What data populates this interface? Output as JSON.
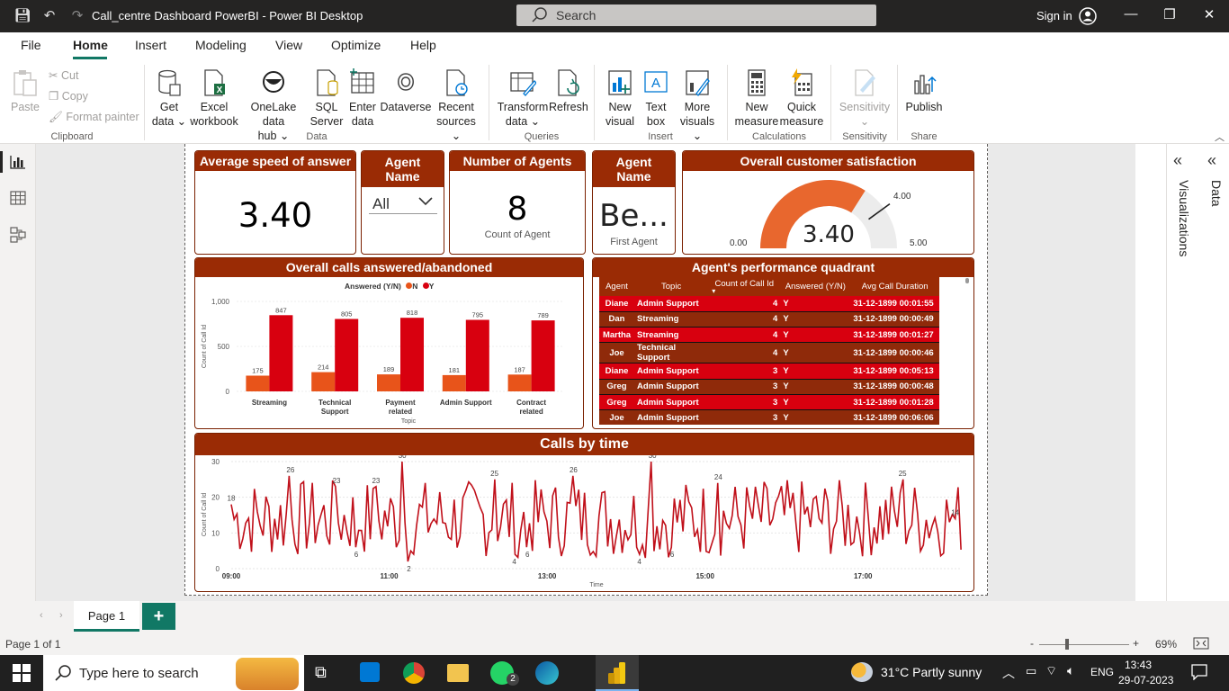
{
  "window": {
    "title": "Call_centre Dashboard PowerBI - Power BI Desktop",
    "search_placeholder": "Search",
    "sign_in": "Sign in"
  },
  "menu": [
    "File",
    "Home",
    "Insert",
    "Modeling",
    "View",
    "Optimize",
    "Help"
  ],
  "ribbon": {
    "clipboard": {
      "paste": "Paste",
      "cut": "Cut",
      "copy": "Copy",
      "format_painter": "Format painter",
      "group": "Clipboard"
    },
    "data": {
      "get_data": [
        "Get",
        "data ⌄"
      ],
      "excel": [
        "Excel",
        "workbook"
      ],
      "onelake": [
        "OneLake data",
        "hub ⌄"
      ],
      "sql": [
        "SQL",
        "Server"
      ],
      "enter": [
        "Enter",
        "data"
      ],
      "dataverse": [
        "Dataverse",
        ""
      ],
      "recent": [
        "Recent",
        "sources ⌄"
      ],
      "group": "Data"
    },
    "queries": {
      "transform": [
        "Transform",
        "data ⌄"
      ],
      "refresh": [
        "Refresh",
        ""
      ],
      "group": "Queries"
    },
    "insert": {
      "new_visual": [
        "New",
        "visual"
      ],
      "text_box": [
        "Text",
        "box"
      ],
      "more_visuals": [
        "More",
        "visuals ⌄"
      ],
      "group": "Insert"
    },
    "calculations": {
      "new_measure": [
        "New",
        "measure"
      ],
      "quick_measure": [
        "Quick",
        "measure"
      ],
      "group": "Calculations"
    },
    "sensitivity": {
      "label": [
        "Sensitivity",
        "⌄"
      ],
      "group": "Sensitivity"
    },
    "share": {
      "publish": [
        "Publish",
        ""
      ],
      "group": "Share"
    }
  },
  "cards": {
    "avg_speed": {
      "title": "Average speed of answer",
      "value": "3.40"
    },
    "agent_slicer": {
      "title": "Agent Name",
      "value": "All"
    },
    "num_agents": {
      "title": "Number of Agents",
      "value": "8",
      "sub": "Count of Agent"
    },
    "first_agent": {
      "title": "Agent Name",
      "value": "Be...",
      "sub": "First Agent"
    },
    "satisfaction": {
      "title": "Overall customer satisfaction",
      "value": "3.40",
      "min": "0.00",
      "max": "5.00",
      "target": "4.00"
    }
  },
  "bar_chart": {
    "title": "Overall calls answered/abandoned",
    "legend_title": "Answered (Y/N)",
    "legend": [
      "N",
      "Y"
    ],
    "xlabel": "Topic",
    "ylabel": "Count of Call Id",
    "ticks": [
      "1,000",
      "500",
      "0"
    ]
  },
  "perf_table": {
    "title": "Agent's performance quadrant",
    "columns": [
      "Agent",
      "Topic",
      "Count of Call Id",
      "Answered (Y/N)",
      "Avg Call Duration"
    ],
    "rows": [
      [
        "Diane",
        "Admin Support",
        "4",
        "Y",
        "31-12-1899 00:01:55"
      ],
      [
        "Dan",
        "Streaming",
        "4",
        "Y",
        "31-12-1899 00:00:49"
      ],
      [
        "Martha",
        "Streaming",
        "4",
        "Y",
        "31-12-1899 00:01:27"
      ],
      [
        "Joe",
        "Technical Support",
        "4",
        "Y",
        "31-12-1899 00:00:46"
      ],
      [
        "Diane",
        "Admin Support",
        "3",
        "Y",
        "31-12-1899 00:05:13"
      ],
      [
        "Greg",
        "Admin Support",
        "3",
        "Y",
        "31-12-1899 00:00:48"
      ],
      [
        "Greg",
        "Admin Support",
        "3",
        "Y",
        "31-12-1899 00:01:28"
      ],
      [
        "Joe",
        "Admin Support",
        "3",
        "Y",
        "31-12-1899 00:06:06"
      ]
    ]
  },
  "line_chart": {
    "title": "Calls by time",
    "xlabel": "Time",
    "ylabel": "Count of Call Id",
    "yticks": [
      "30",
      "20",
      "10",
      "0"
    ],
    "xticks": [
      "09:00",
      "11:00",
      "13:00",
      "15:00",
      "17:00"
    ]
  },
  "chart_data": [
    {
      "type": "bar",
      "title": "Overall calls answered/abandoned",
      "xlabel": "Topic",
      "ylabel": "Count of Call Id",
      "ylim": [
        0,
        1000
      ],
      "categories": [
        "Streaming",
        "Technical Support",
        "Payment related",
        "Admin Support",
        "Contract related"
      ],
      "series": [
        {
          "name": "N",
          "color": "#e8541a",
          "values": [
            175,
            214,
            189,
            181,
            187
          ]
        },
        {
          "name": "Y",
          "color": "#d8000f",
          "values": [
            847,
            805,
            818,
            795,
            789
          ]
        }
      ]
    },
    {
      "type": "line",
      "title": "Calls by time",
      "xlabel": "Time",
      "ylabel": "Count of Call Id",
      "ylim": [
        0,
        30
      ],
      "xrange": [
        "09:00",
        "18:15"
      ],
      "color": "#c0101a",
      "labeled_points": [
        {
          "x": "09:00",
          "y": 18
        },
        {
          "x": "09:45",
          "y": 26
        },
        {
          "x": "10:20",
          "y": 23
        },
        {
          "x": "10:35",
          "y": 6
        },
        {
          "x": "10:50",
          "y": 23
        },
        {
          "x": "11:10",
          "y": 30
        },
        {
          "x": "11:15",
          "y": 2
        },
        {
          "x": "12:20",
          "y": 25
        },
        {
          "x": "12:35",
          "y": 4
        },
        {
          "x": "12:45",
          "y": 6
        },
        {
          "x": "13:20",
          "y": 26
        },
        {
          "x": "14:10",
          "y": 4
        },
        {
          "x": "14:20",
          "y": 30
        },
        {
          "x": "14:35",
          "y": 6
        },
        {
          "x": "15:10",
          "y": 24
        },
        {
          "x": "17:30",
          "y": 25
        },
        {
          "x": "18:10",
          "y": 14
        }
      ]
    },
    {
      "type": "gauge",
      "title": "Overall customer satisfaction",
      "value": 3.4,
      "min": 0,
      "max": 5,
      "target": 4.0
    }
  ],
  "right_panes": {
    "visualizations": "Visualizations",
    "data": "Data"
  },
  "pages": {
    "tab": "Page 1",
    "add": "+"
  },
  "status": {
    "page": "Page 1 of 1",
    "zoom": "69%",
    "zoom_minus": "-",
    "zoom_plus": "+"
  },
  "taskbar": {
    "search": "Type here to search",
    "weather": "31°C  Partly sunny",
    "lang": "ENG",
    "time": "13:43",
    "date": "29-07-2023",
    "whatsapp_badge": "2"
  }
}
